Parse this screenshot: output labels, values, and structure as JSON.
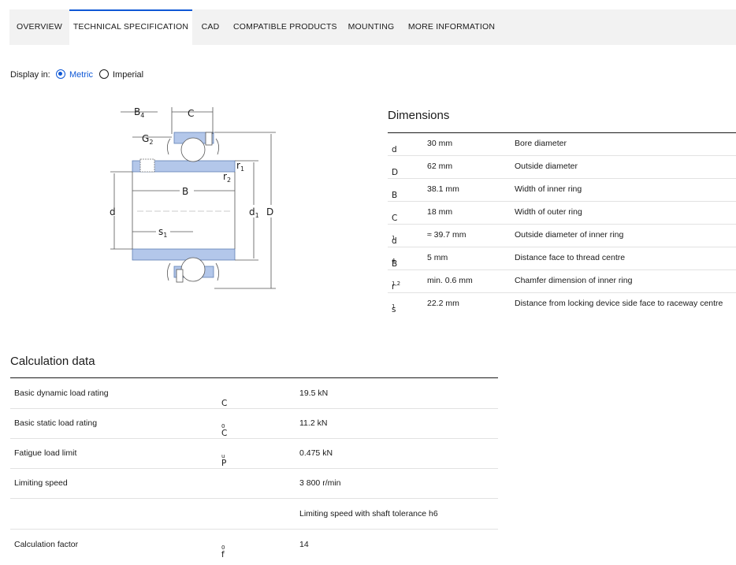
{
  "tabs": [
    {
      "label": "OVERVIEW",
      "active": false
    },
    {
      "label": "TECHNICAL SPECIFICATION",
      "active": true
    },
    {
      "label": "CAD",
      "active": false
    },
    {
      "label": "COMPATIBLE PRODUCTS",
      "active": false
    },
    {
      "label": "MOUNTING",
      "active": false
    },
    {
      "label": "MORE INFORMATION",
      "active": false
    }
  ],
  "display": {
    "label": "Display in:",
    "options": [
      {
        "label": "Metric",
        "selected": true
      },
      {
        "label": "Imperial",
        "selected": false
      }
    ]
  },
  "drawing": {
    "labels": {
      "B4": "B",
      "B4_sub": "4",
      "C": "C",
      "G2": "G",
      "G2_sub": "2",
      "r1": "r",
      "r1_sub": "1",
      "r2": "r",
      "r2_sub": "2",
      "B": "B",
      "d": "d",
      "d1": "d",
      "d1_sub": "1",
      "D": "D",
      "s1": "s",
      "s1_sub": "1"
    }
  },
  "dimensions": {
    "title": "Dimensions",
    "rows": [
      {
        "symbol": "d",
        "sub": "",
        "value": "30 mm",
        "desc": "Bore diameter"
      },
      {
        "symbol": "D",
        "sub": "",
        "value": "62 mm",
        "desc": "Outside diameter"
      },
      {
        "symbol": "B",
        "sub": "",
        "value": "38.1 mm",
        "desc": "Width of inner ring"
      },
      {
        "symbol": "C",
        "sub": "",
        "value": "18 mm",
        "desc": "Width of outer ring"
      },
      {
        "symbol": "d",
        "sub": "1",
        "value": "≈ 39.7 mm",
        "desc": "Outside diameter of inner ring"
      },
      {
        "symbol": "B",
        "sub": "4",
        "value": "5 mm",
        "desc": "Distance face to thread centre"
      },
      {
        "symbol": "r",
        "sub": "1,2",
        "value": "min. 0.6 mm",
        "desc": "Chamfer dimension of inner ring"
      },
      {
        "symbol": "s",
        "sub": "1",
        "value": "22.2 mm",
        "desc": "Distance from locking device side face to raceway centre"
      }
    ]
  },
  "calculation": {
    "title": "Calculation data",
    "rows": [
      {
        "name": "Basic dynamic load rating",
        "symbol": "C",
        "sub": "",
        "value": "19.5 kN"
      },
      {
        "name": "Basic static load rating",
        "symbol": "C",
        "sub": "0",
        "value": "11.2 kN"
      },
      {
        "name": "Fatigue load limit",
        "symbol": "P",
        "sub": "u",
        "value": "0.475 kN"
      },
      {
        "name": "Limiting speed",
        "symbol": "",
        "sub": "",
        "value": "3 800 r/min"
      },
      {
        "name": "",
        "symbol": "",
        "sub": "",
        "value": "Limiting speed with shaft tolerance h6"
      },
      {
        "name": "Calculation factor",
        "symbol": "f",
        "sub": "0",
        "value": "14"
      }
    ]
  },
  "colors": {
    "accent": "#0f58d6",
    "part_fill": "#b3c7ea",
    "part_stroke": "#5f7fb5"
  }
}
